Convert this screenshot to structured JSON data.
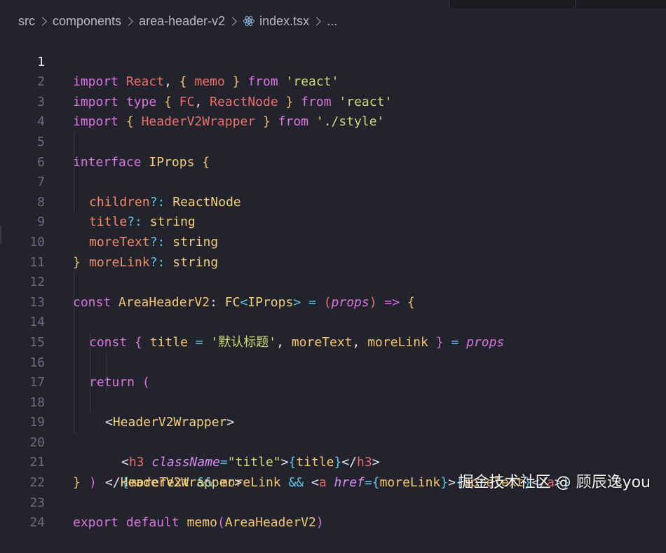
{
  "breadcrumb": {
    "parts": [
      "src",
      "components",
      "area-header-v2",
      "index.tsx",
      "..."
    ],
    "file_icon": "react-icon"
  },
  "line_numbers": [
    "1",
    "2",
    "3",
    "4",
    "5",
    "6",
    "7",
    "8",
    "9",
    "10",
    "11",
    "12",
    "13",
    "14",
    "15",
    "16",
    "17",
    "18",
    "19",
    "20",
    "21",
    "22",
    "23",
    "24"
  ],
  "code": {
    "l1": [
      "import",
      " ",
      "React",
      ", ",
      "{",
      " ",
      "memo",
      " ",
      "}",
      " ",
      "from",
      " ",
      "'react'"
    ],
    "l2": [
      "import",
      " ",
      "type",
      " ",
      "{",
      " ",
      "FC",
      ", ",
      "ReactNode",
      " ",
      "}",
      " ",
      "from",
      " ",
      "'react'"
    ],
    "l3": [
      "import",
      " ",
      "{",
      " ",
      "HeaderV2Wrapper",
      " ",
      "}",
      " ",
      "from",
      " ",
      "'./style'"
    ],
    "l5": [
      "interface",
      " ",
      "IProps",
      " ",
      "{"
    ],
    "l6": [
      "children",
      "?:",
      " ",
      "ReactNode"
    ],
    "l7": [
      "title",
      "?:",
      " ",
      "string"
    ],
    "l8": [
      "moreText",
      "?:",
      " ",
      "string"
    ],
    "l9": [
      "moreLink",
      "?:",
      " ",
      "string"
    ],
    "l10": [
      "}"
    ],
    "l12": [
      "const",
      " ",
      "AreaHeaderV2",
      ": ",
      "FC",
      "<",
      "IProps",
      ">",
      " ",
      "=",
      " ",
      "(",
      "props",
      ")",
      " ",
      "=>",
      " ",
      "{"
    ],
    "l13": [
      "const",
      " ",
      "{",
      " ",
      "title",
      " ",
      "=",
      " ",
      "'默认标题'",
      ", ",
      "moreText",
      ", ",
      "moreLink",
      " ",
      "}",
      " ",
      "=",
      " ",
      "props"
    ],
    "l15": [
      "return",
      " ",
      "("
    ],
    "l16": [
      "<",
      "HeaderV2Wrapper",
      ">"
    ],
    "l17": [
      "<",
      "h3",
      " ",
      "className",
      "=",
      "\"title\"",
      ">",
      "{",
      "title",
      "}",
      "</",
      "h3",
      ">"
    ],
    "l18": [
      "{",
      "moreText",
      " ",
      "&&",
      " ",
      "moreLink",
      " ",
      "&&",
      " ",
      "<",
      "a",
      " ",
      "href",
      "=",
      "{",
      "moreLink",
      "}",
      ">",
      "{",
      "moreText",
      "}",
      "</",
      "a",
      ">",
      "}"
    ],
    "l19": [
      "</",
      "HeaderV2Wrapper",
      ">"
    ],
    "l20": [
      ")"
    ],
    "l21": [
      "}"
    ],
    "l23": [
      "export",
      " ",
      "default",
      " ",
      "memo",
      "(",
      "AreaHeaderV2",
      ")"
    ]
  },
  "watermark": "掘金技术社区 @ 顾辰逸you",
  "colors": {
    "background": "#23232e",
    "keyword": "#d875dc",
    "string": "#c9da74",
    "type": "#f2cf7a",
    "tag": "#e06c75",
    "operator": "#5ec7e6"
  }
}
